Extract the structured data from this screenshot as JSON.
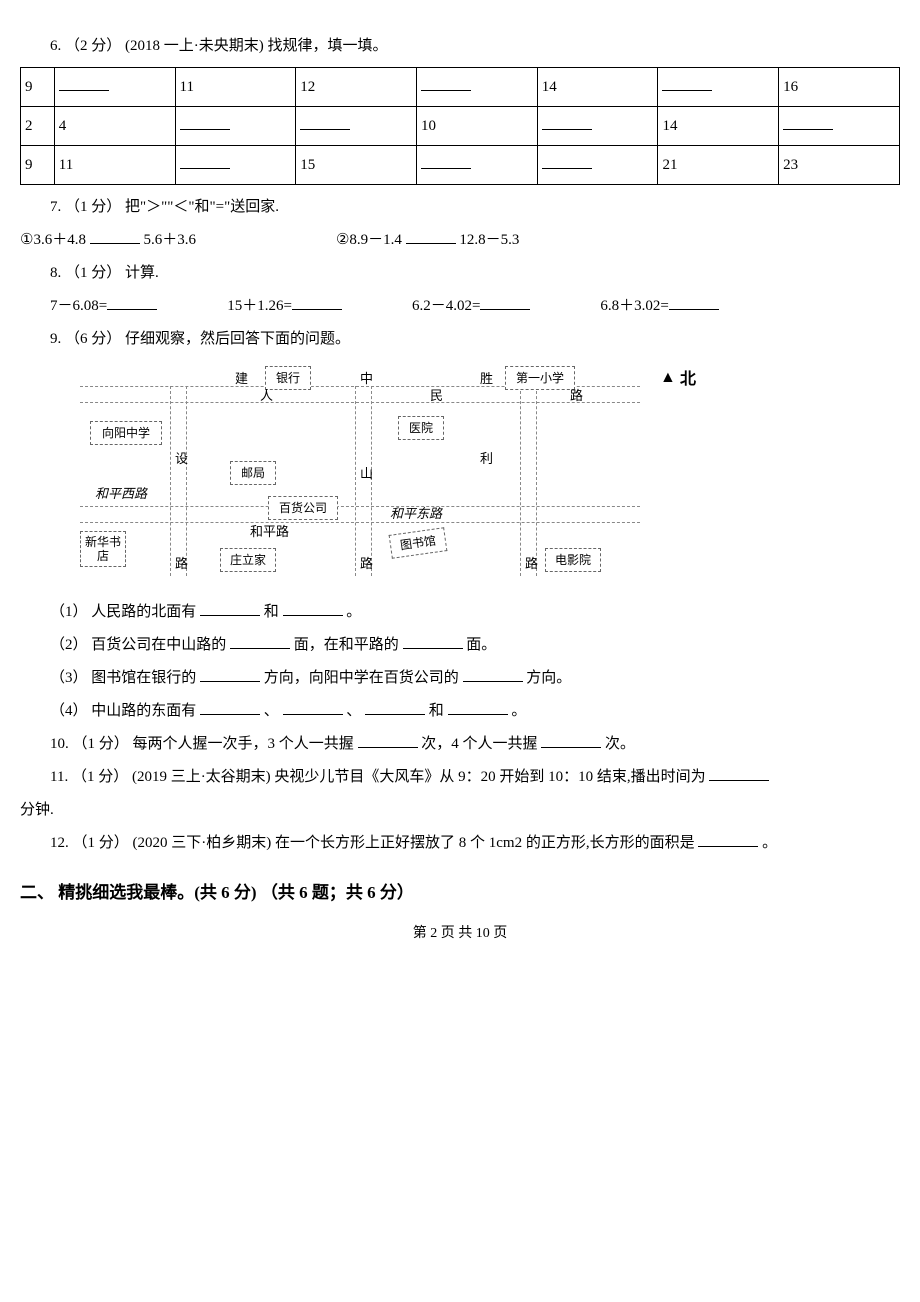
{
  "q6": {
    "prompt": "6. （2 分） (2018 一上·未央期末) 找规律，填一填。",
    "rows": [
      [
        "9",
        "",
        "11",
        "12",
        "",
        "14",
        "",
        "16"
      ],
      [
        "2",
        "4",
        "",
        "",
        "10",
        "",
        "14",
        ""
      ],
      [
        "9",
        "11",
        "",
        "15",
        "",
        "",
        "21",
        "23"
      ]
    ]
  },
  "q7": {
    "prompt": "7. （1 分） 把\"＞\"\"＜\"和\"=\"送回家.",
    "item1_left": "①3.6＋4.8",
    "item1_right": "5.6＋3.6",
    "item2_left": "②8.9－1.4",
    "item2_right": "12.8－5.3"
  },
  "q8": {
    "prompt": "8. （1 分） 计算.",
    "c1": "7－6.08=",
    "c2": "15＋1.26=",
    "c3": "6.2－4.02=",
    "c4": "6.8＋3.02="
  },
  "q9": {
    "prompt": "9. （6 分） 仔细观察，然后回答下面的问题。",
    "map": {
      "bank": "银行",
      "school1": "第一小学",
      "xiangyang": "向阳中学",
      "hospital": "医院",
      "post": "邮局",
      "baihuo": "百货公司",
      "library": "图书馆",
      "cinema": "电影院",
      "xinhua": "新华书店",
      "zhuang": "庄立家",
      "jian": "建",
      "she": "设",
      "lu": "路",
      "ren": "人",
      "zhong": "中",
      "min": "民",
      "shan": "山",
      "sheng": "胜",
      "li": "利",
      "hepingxi": "和平西路",
      "hepinglu": "和平路",
      "hepingdong": "和平东路",
      "north": "北"
    },
    "s1_a": "（1） 人民路的北面有",
    "s1_b": "和",
    "s1_c": "。",
    "s2_a": "（2） 百货公司在中山路的",
    "s2_b": "面，在和平路的",
    "s2_c": "面。",
    "s3_a": "（3） 图书馆在银行的",
    "s3_b": "方向，向阳中学在百货公司的",
    "s3_c": "方向。",
    "s4_a": "（4） 中山路的东面有",
    "s4_sep": "、",
    "s4_and": "和",
    "s4_end": "。"
  },
  "q10": {
    "a": "10. （1 分） 每两个人握一次手，3 个人一共握",
    "b": "次，4 个人一共握",
    "c": "次。"
  },
  "q11": {
    "a": "11. （1 分） (2019 三上·太谷期末) 央视少儿节目《大风车》从 9：20 开始到 10：10 结束,播出时间为",
    "b": "分钟."
  },
  "q12": {
    "a": "12. （1 分） (2020 三下·柏乡期末) 在一个长方形上正好摆放了 8 个 1cm2 的正方形,长方形的面积是",
    "b": "。"
  },
  "section2": "二、 精挑细选我最棒。(共 6 分) （共 6 题；共 6 分）",
  "footer": "第 2 页 共 10 页"
}
